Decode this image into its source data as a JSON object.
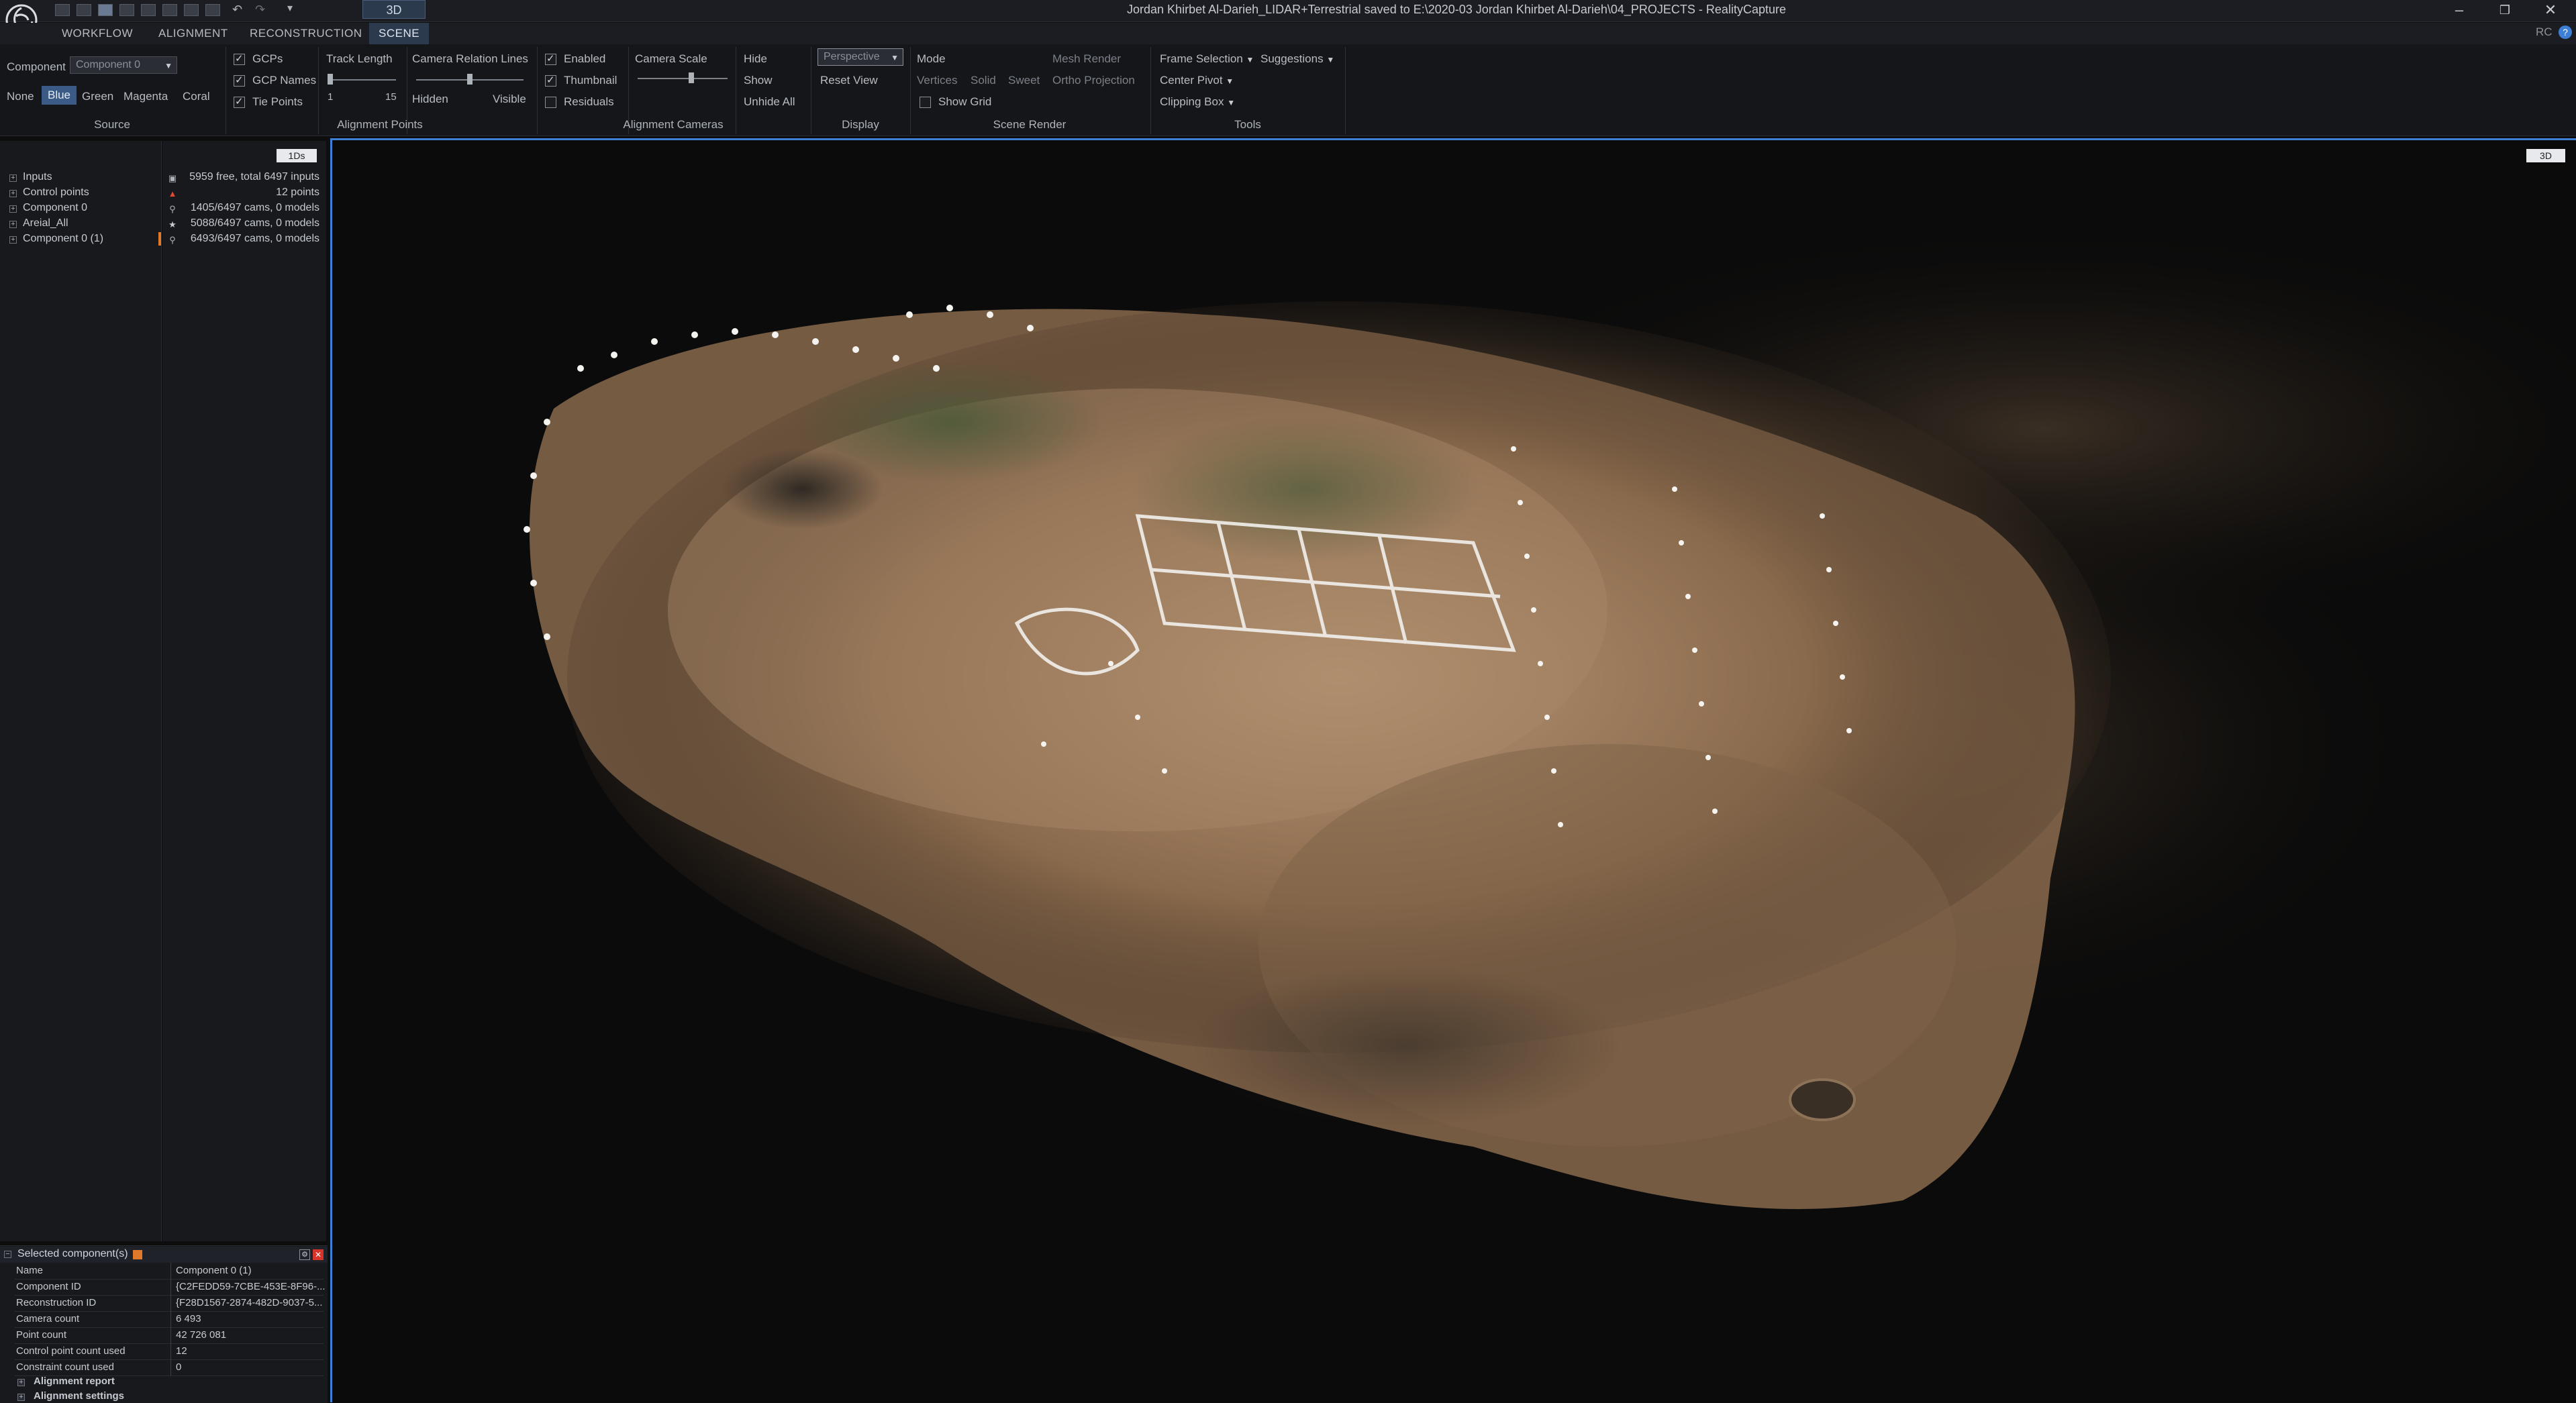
{
  "titlebar": {
    "tab_3d": "3D",
    "title": "Jordan Khirbet Al-Darieh_LIDAR+Terrestrial saved to E:\\2020-03 Jordan Khirbet Al-Darieh\\04_PROJECTS - RealityCapture",
    "minimize": "–",
    "restore": "❐",
    "close": "✕",
    "rc_label": "RC"
  },
  "menu": [
    "WORKFLOW",
    "ALIGNMENT",
    "RECONSTRUCTION",
    "SCENE"
  ],
  "ribbon": {
    "source": {
      "label": "Source",
      "component_label": "Component",
      "component_value": "Component 0",
      "colors": [
        "None",
        "Blue",
        "Green",
        "Magenta",
        "Coral"
      ]
    },
    "alignment_points": {
      "label": "Alignment Points",
      "gcps": "GCPs",
      "gcp_names": "GCP Names",
      "tie_points": "Tie Points",
      "track_length": "Track Length",
      "track_min": "1",
      "track_max": "15",
      "camera_relation_lines": "Camera Relation Lines",
      "hidden": "Hidden",
      "visible": "Visible"
    },
    "alignment_cameras": {
      "label": "Alignment Cameras",
      "enabled": "Enabled",
      "thumbnail": "Thumbnail",
      "residuals": "Residuals",
      "camera_scale": "Camera Scale",
      "hide": "Hide",
      "show": "Show",
      "unhide_all": "Unhide All"
    },
    "display": {
      "label": "Display",
      "projection": "Perspective",
      "reset_view": "Reset View"
    },
    "scene_render": {
      "label": "Scene Render",
      "mode": "Mode",
      "mesh_render": "Mesh Render",
      "vertices": "Vertices",
      "solid": "Solid",
      "sweet": "Sweet",
      "ortho_projection": "Ortho Projection",
      "show_grid": "Show Grid"
    },
    "tools": {
      "label": "Tools",
      "frame_selection": "Frame Selection",
      "suggestions": "Suggestions",
      "center_pivot": "Center Pivot",
      "clipping_box": "Clipping Box"
    }
  },
  "tree": {
    "items": [
      "Inputs",
      "Control points",
      "Component 0",
      "Areial_All",
      "Component 0 (1)"
    ]
  },
  "info": {
    "badge": "1Ds",
    "lines": [
      "5959 free, total 6497 inputs",
      "12 points",
      "1405/6497 cams, 0 models",
      "5088/6497 cams, 0 models",
      "6493/6497 cams, 0 models"
    ]
  },
  "selected": {
    "header": "Selected component(s)",
    "rows": [
      {
        "key": "Name",
        "value": "Component 0 (1)"
      },
      {
        "key": "Component ID",
        "value": "{C2FEDD59-7CBE-453E-8F96-..."
      },
      {
        "key": "Reconstruction ID",
        "value": "{F28D1567-2874-482D-9037-5..."
      },
      {
        "key": "Camera count",
        "value": "6 493"
      },
      {
        "key": "Point count",
        "value": "42 726 081"
      },
      {
        "key": "Control point count used",
        "value": "12"
      },
      {
        "key": "Constraint count used",
        "value": "0"
      }
    ],
    "alignment_report": "Alignment report",
    "alignment_settings": "Alignment settings"
  },
  "viewport": {
    "badge": "3D"
  }
}
